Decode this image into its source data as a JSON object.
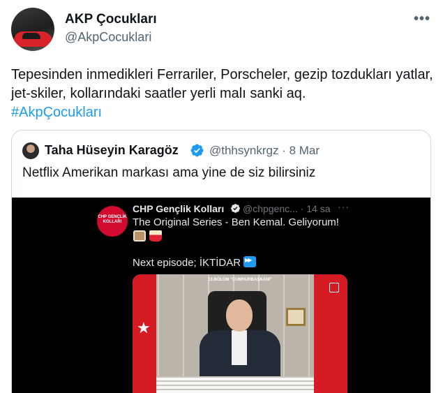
{
  "author": {
    "name": "AKP Çocukları",
    "handle": "@AkpCocuklari"
  },
  "more_glyph": "•••",
  "tweet": {
    "text": "Tepesinden inmedikleri Ferrariler, Porscheler, gezip tozdukları yatlar, jet-skiler, kollarındaki saatler yerli malı sanki aq.",
    "hashtag": "#AkpÇocukları"
  },
  "quote": {
    "name": "Taha Hüseyin Karagöz",
    "handle": "@thhsynkrgz · 8 Mar",
    "text": "Netflix Amerikan markası ama yine de siz bilirsiniz",
    "media": {
      "avatar_text": "CHP GENÇLİK KOLLARI",
      "name": "CHP Gençlik Kolları",
      "handle": "@chpgenc... · 14 sa",
      "more_glyph": "···",
      "text": "The Original Series - Ben Kemal. Geliyorum!",
      "next": "Next episode; İKTİDAR",
      "video_caption": "13.BÖLÜM \"CUMHURBAŞKANI\""
    }
  },
  "colors": {
    "accent": "#1d9bf0",
    "text": "#0f1419",
    "muted": "#536471",
    "border": "#cfd9de"
  },
  "icons": [
    "verified-badge-icon",
    "more-icon",
    "fast-forward-icon",
    "volume-icon"
  ]
}
